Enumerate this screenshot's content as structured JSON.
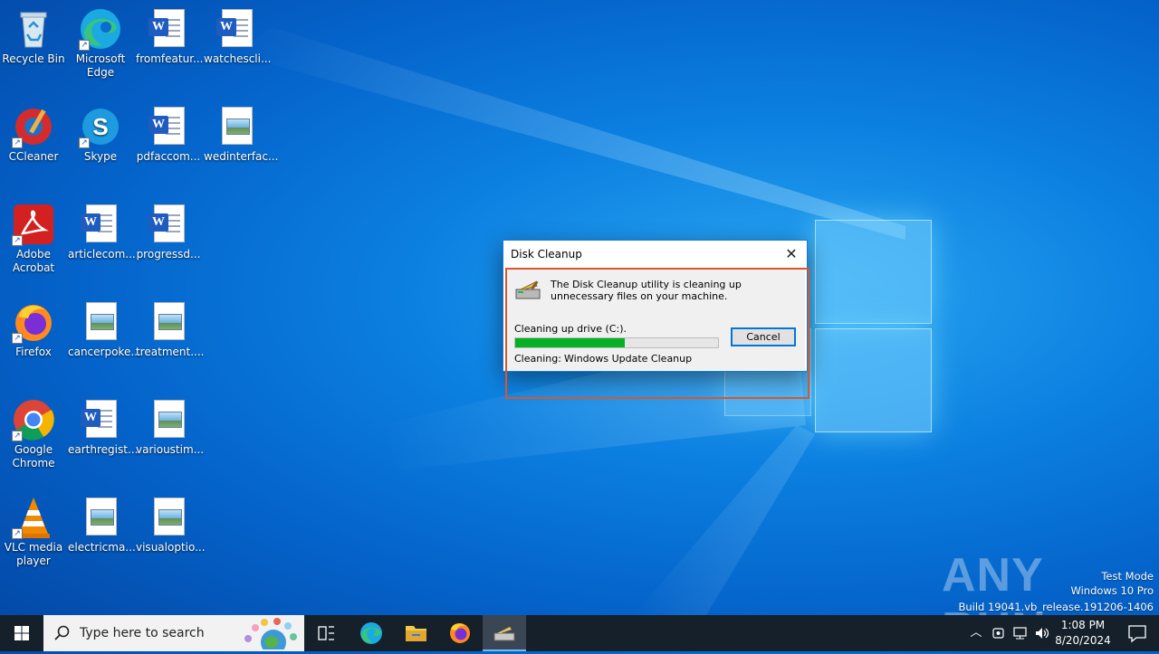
{
  "desktop": {
    "icons": [
      {
        "label": "Recycle Bin",
        "icon": "recycle-bin-icon"
      },
      {
        "label": "Microsoft Edge",
        "icon": "edge-icon"
      },
      {
        "label": "fromfeatur...",
        "icon": "word-document-icon"
      },
      {
        "label": "watchescli...",
        "icon": "word-document-icon"
      },
      {
        "label": "CCleaner",
        "icon": "ccleaner-icon"
      },
      {
        "label": "Skype",
        "icon": "skype-icon"
      },
      {
        "label": "pdfaccom...",
        "icon": "word-document-icon"
      },
      {
        "label": "wedinterfac...",
        "icon": "image-file-icon"
      },
      {
        "label": "Adobe Acrobat",
        "icon": "acrobat-icon"
      },
      {
        "label": "articlecom...",
        "icon": "word-document-icon"
      },
      {
        "label": "progressd...",
        "icon": "word-document-icon"
      },
      {
        "label": "Firefox",
        "icon": "firefox-icon"
      },
      {
        "label": "cancerpoke...",
        "icon": "image-file-icon"
      },
      {
        "label": "treatment....",
        "icon": "image-file-icon"
      },
      {
        "label": "Google Chrome",
        "icon": "chrome-icon"
      },
      {
        "label": "earthregist...",
        "icon": "word-document-icon"
      },
      {
        "label": "varioustim...",
        "icon": "image-file-icon"
      },
      {
        "label": "VLC media player",
        "icon": "vlc-icon"
      },
      {
        "label": "electricma...",
        "icon": "image-file-icon"
      },
      {
        "label": "visualoptio...",
        "icon": "image-file-icon"
      }
    ]
  },
  "dialog": {
    "title": "Disk Cleanup",
    "message": "The Disk Cleanup utility is cleaning up unnecessary files on your machine.",
    "status_label": "Cleaning up drive  (C:).",
    "progress_percent": 54,
    "cancel_label": "Cancel",
    "cleaning_label": "Cleaning:",
    "cleaning_value": "Windows Update Cleanup"
  },
  "watermark": {
    "brand": "ANY RUN",
    "line1": "Test Mode",
    "line2": "Windows 10 Pro",
    "line3": "Build 19041.vb_release.191206-1406"
  },
  "taskbar": {
    "search_placeholder": "Type here to search",
    "time": "1:08 PM",
    "date": "8/20/2024"
  },
  "colors": {
    "progress_fill": "#06b025",
    "taskbar_bg": "#15202b",
    "accent": "#0078d7"
  }
}
